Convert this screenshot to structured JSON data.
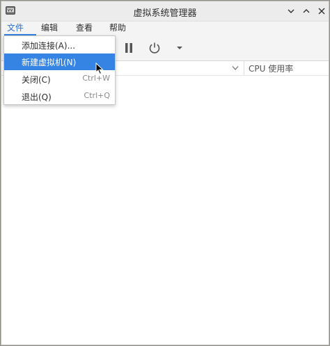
{
  "window": {
    "title": "虚拟系统管理器"
  },
  "titlebar": {
    "app_icon": "virt-manager-icon",
    "buttons": [
      "minimize-icon",
      "maximize-icon",
      "close-icon"
    ]
  },
  "menubar": {
    "items": [
      {
        "label": "文件(F)"
      },
      {
        "label": "编辑(E)"
      },
      {
        "label": "查看(V)"
      },
      {
        "label": "帮助(H)"
      }
    ],
    "active": "文件(F)"
  },
  "toolbar": {
    "icons": [
      "pause-icon",
      "power-icon",
      "dropdown-arrow-icon"
    ]
  },
  "list_header": {
    "cpu_label": "CPU 使用率"
  },
  "file_menu": {
    "items": [
      {
        "label": "添加连接(A)...",
        "accel": ""
      },
      {
        "label": "新建虚拟机(N)",
        "accel": "",
        "highlighted": true
      },
      {
        "label": "关闭(C)",
        "accel": "Ctrl+W"
      },
      {
        "label": "退出(Q)",
        "accel": "Ctrl+Q"
      }
    ]
  },
  "colors": {
    "accent": "#3584e4",
    "menu_active_text": "#2b6fd4",
    "chrome": "#ececec"
  }
}
